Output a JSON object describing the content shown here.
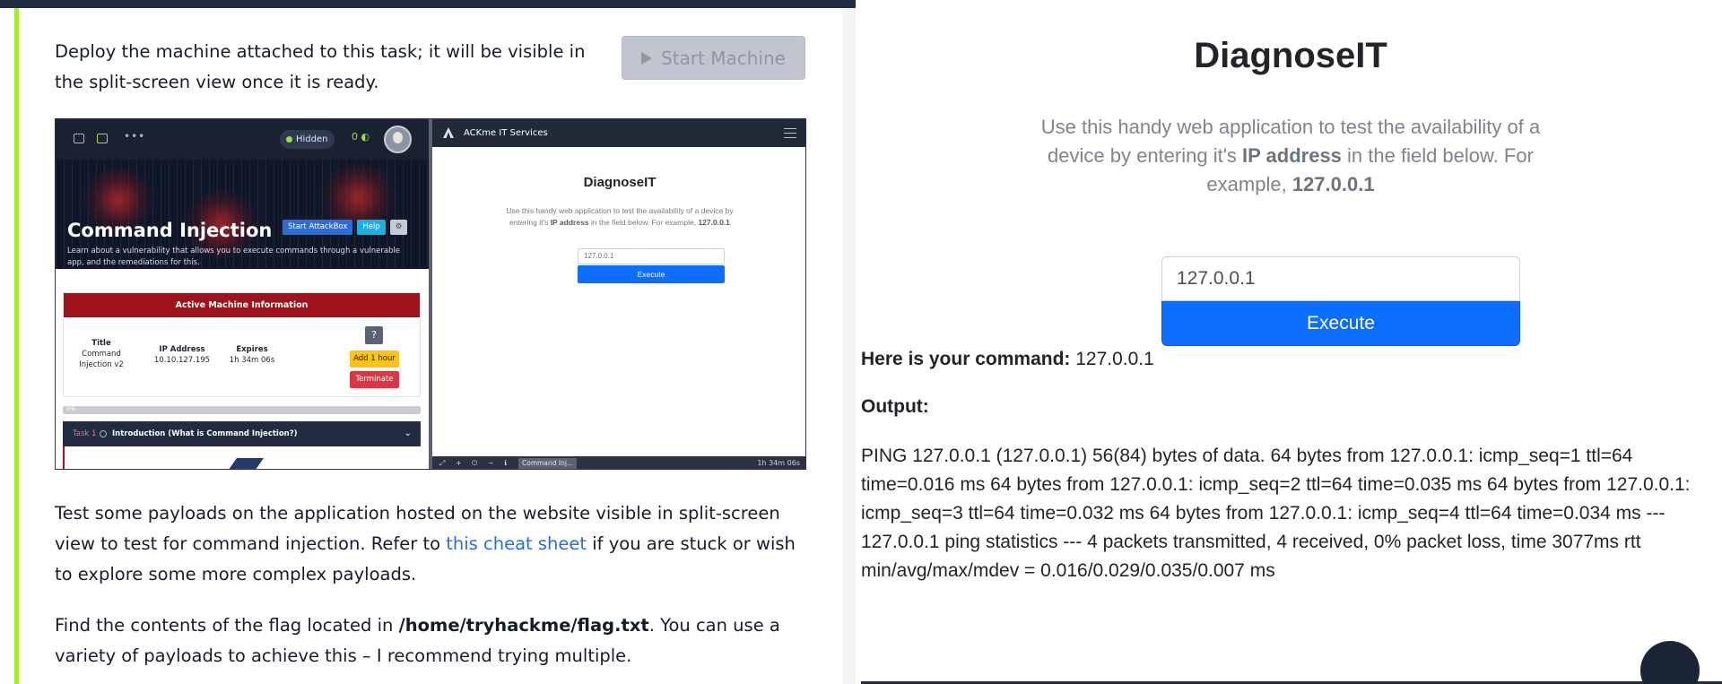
{
  "task": {
    "p1": "Deploy the machine attached to this task; it will be visible in the split-screen view once it is ready.",
    "start_button": "Start Machine",
    "p2_before": "Test some payloads on the application hosted on the website visible in split-screen view to test for command injection. Refer to ",
    "p2_link": "this cheat sheet",
    "p2_after": " if you are stuck or wish to explore some more complex payloads.",
    "p3_before": "Find the contents of the flag located in ",
    "p3_path": "/home/tryhackme/flag.txt",
    "p3_after": ". You can use a variety of payloads to achieve this – I recommend trying multiple."
  },
  "screenshot": {
    "nav": {
      "hidden_label": "Hidden",
      "streak": "0"
    },
    "hero": {
      "title": "Command Injection",
      "subtitle": "Learn about a vulnerability that allows you to execute commands through a vulnerable app, and the remediations for this.",
      "start_attackbox": "Start AttackBox",
      "help": "Help"
    },
    "machine": {
      "header": "Active Machine Information",
      "title_label": "Title",
      "title_value": "Command Injection v2",
      "ip_label": "IP Address",
      "ip_value": "10.10.127.195",
      "expires_label": "Expires",
      "expires_value": "1h 34m 06s",
      "help_q": "?",
      "add_hour": "Add 1 hour",
      "terminate": "Terminate"
    },
    "progress": {
      "label": "0%",
      "fraction": 0.0
    },
    "task_row": {
      "number": "Task 1",
      "title": "Introduction (What is Command Injection?)"
    },
    "split": {
      "brand": "ACKme IT Services",
      "title": "DiagnoseIT",
      "desc_a": "Use this handy web application to test the availability of a device by entering it's ",
      "desc_b": "IP address",
      "desc_c": " in the field below. For example, ",
      "desc_d": "127.0.0.1",
      "input_value": "127.0.0.1",
      "execute": "Execute",
      "taskbar_chip": "Command Inj...",
      "clock": "1h 34m 06s"
    }
  },
  "app": {
    "title": "DiagnoseIT",
    "desc_a": "Use this handy web application to test the availability of a device by entering it's ",
    "desc_b": "IP address",
    "desc_c": " in the field below. For example, ",
    "desc_d": "127.0.0.1",
    "input_value": "127.0.0.1",
    "execute_label": "Execute",
    "command_label": "Here is your command:",
    "command_value": " 127.0.0.1",
    "output_label": "Output:",
    "output_text": "PING 127.0.0.1 (127.0.0.1) 56(84) bytes of data. 64 bytes from 127.0.0.1: icmp_seq=1 ttl=64 time=0.016 ms 64 bytes from 127.0.0.1: icmp_seq=2 ttl=64 time=0.035 ms 64 bytes from 127.0.0.1: icmp_seq=3 ttl=64 time=0.032 ms 64 bytes from 127.0.0.1: icmp_seq=4 ttl=64 time=0.034 ms --- 127.0.0.1 ping statistics --- 4 packets transmitted, 4 received, 0% packet loss, time 3077ms rtt min/avg/max/mdev = 0.016/0.029/0.035/0.007 ms"
  },
  "colors": {
    "accent_green": "#a3ea2a",
    "nav_dark": "#212c42",
    "link_blue": "#2a6cdc",
    "execute_blue": "#0d6efd",
    "machine_red": "#a1111a"
  },
  "icons": [
    "play-icon",
    "window-icon",
    "book-icon",
    "more-icon",
    "streak-icon",
    "settings-icon",
    "chevron-down-icon",
    "menu-icon",
    "chat-icon"
  ]
}
